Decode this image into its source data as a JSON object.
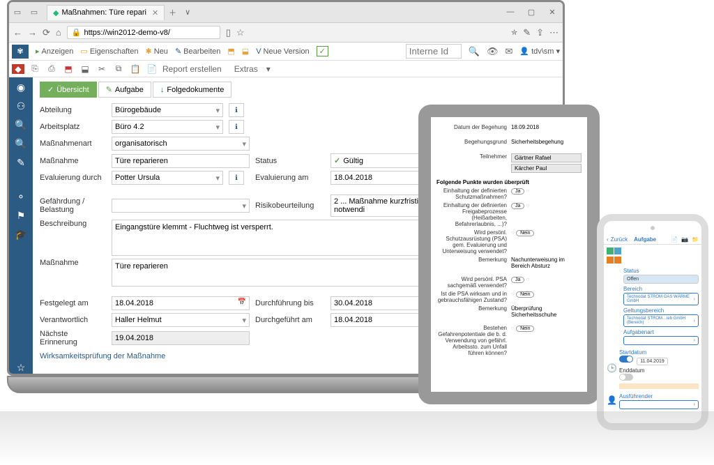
{
  "browser": {
    "tab_title": "Maßnahmen: Türe repari",
    "url": "https://win2012-demo-v8/"
  },
  "toolbar": {
    "anzeigen": "Anzeigen",
    "eigenschaften": "Eigenschaften",
    "neu": "Neu",
    "bearbeiten": "Bearbeiten",
    "neue_version": "Neue Version",
    "interne_id_ph": "Interne Id",
    "user": "tdv\\sm",
    "report": "Report erstellen",
    "extras": "Extras"
  },
  "tabs": {
    "uebersicht": "Übersicht",
    "aufgabe": "Aufgabe",
    "folgedokumente": "Folgedokumente"
  },
  "labels": {
    "abteilung": "Abteilung",
    "arbeitsplatz": "Arbeitsplatz",
    "massnahmenart": "Maßnahmenart",
    "massnahme": "Maßnahme",
    "evaluierung_durch": "Evaluierung durch",
    "status": "Status",
    "evaluierung_am": "Evaluierung am",
    "gefaehrdung": "Gefährdung / Belastung",
    "risiko": "Risikobeurteilung",
    "beschreibung": "Beschreibung",
    "festgelegt_am": "Festgelegt am",
    "verantwortlich": "Verantwortlich",
    "naechste": "Nächste Erinnerung",
    "durchfuehrung_bis": "Durchführung bis",
    "durchgefuehrt_am": "Durchgeführt am",
    "wirksamkeit": "Wirksamkeitsprüfung der Maßnahme"
  },
  "values": {
    "abteilung": "Bürogebäude",
    "arbeitsplatz": "Büro 4.2",
    "massnahmenart": "organisatorisch",
    "massnahme": "Türe reparieren",
    "evaluierung_durch": "Potter Ursula",
    "status": "Gültig",
    "evaluierung_am": "18.04.2018",
    "risiko": "2 ... Maßnahme kurzfristig notwendi",
    "beschreibung": "Eingangstüre klemmt - Fluchtweg ist versperrt.",
    "massnahme2": "Türe reparieren",
    "festgelegt_am": "18.04.2018",
    "verantwortlich": "Haller Helmut",
    "naechste": "19.04.2018",
    "durchfuehrung_bis": "30.04.2018",
    "durchgefuehrt_am": "18.04.2018"
  },
  "tablet": {
    "labels": {
      "datum": "Datum der Begehung",
      "grund": "Begehungsgrund",
      "teilnehmer": "Teilnehmer",
      "heading": "Folgende Punkte wurden überprüft",
      "q1": "Einhaltung der definierten Schutzmaßnahmen?",
      "q2": "Einhaltung der definierten Freigabeprozesse (Heißarbeiten, Befahrerlaubnis, ...)?",
      "q3": "Wird persönl. Schutzausrüstung (PSA) gem. Evaluierung und Unterweisung verwendet?",
      "bemerk": "Bemerkung",
      "q4": "Wird persönl. PSA sachgemäß verwendet?",
      "q5": "Ist die PSA wirksam und in gebrauchsfähigen Zustand?",
      "q6": "Bestehen Gefahrenpotentiale die b. d. Verwendung von gefährl. Arbeitssto. zum Unfall führen können?"
    },
    "values": {
      "datum": "18.09.2018",
      "grund": "Sicherheitsbegehung",
      "teilnehmer1": "Gärtner Rafael",
      "teilnehmer2": "Kärcher Paul",
      "bemerk1": "Nachunterweisung im Bereich Absturz",
      "bemerk2": "Überprüfung Sicherheitsschuhe",
      "ja": "Ja",
      "nein": "Nein"
    }
  },
  "phone": {
    "back": "Zurück",
    "title": "Aufgabe",
    "sec": {
      "status": "Status",
      "bereich": "Bereich",
      "geltung": "Geltungsbereich",
      "aufgabenart": "Aufgabenart",
      "startdatum": "Startdatum",
      "enddatum": "Enddatum",
      "ausfuehrender": "Ausführender"
    },
    "val": {
      "status": "Offen",
      "bereich": "Technodat STROM GAS WÄRME GmbH",
      "geltung": "Technodat STROM…ieb GmbH (Bereich)",
      "startdatum": "11.04.2019"
    }
  }
}
